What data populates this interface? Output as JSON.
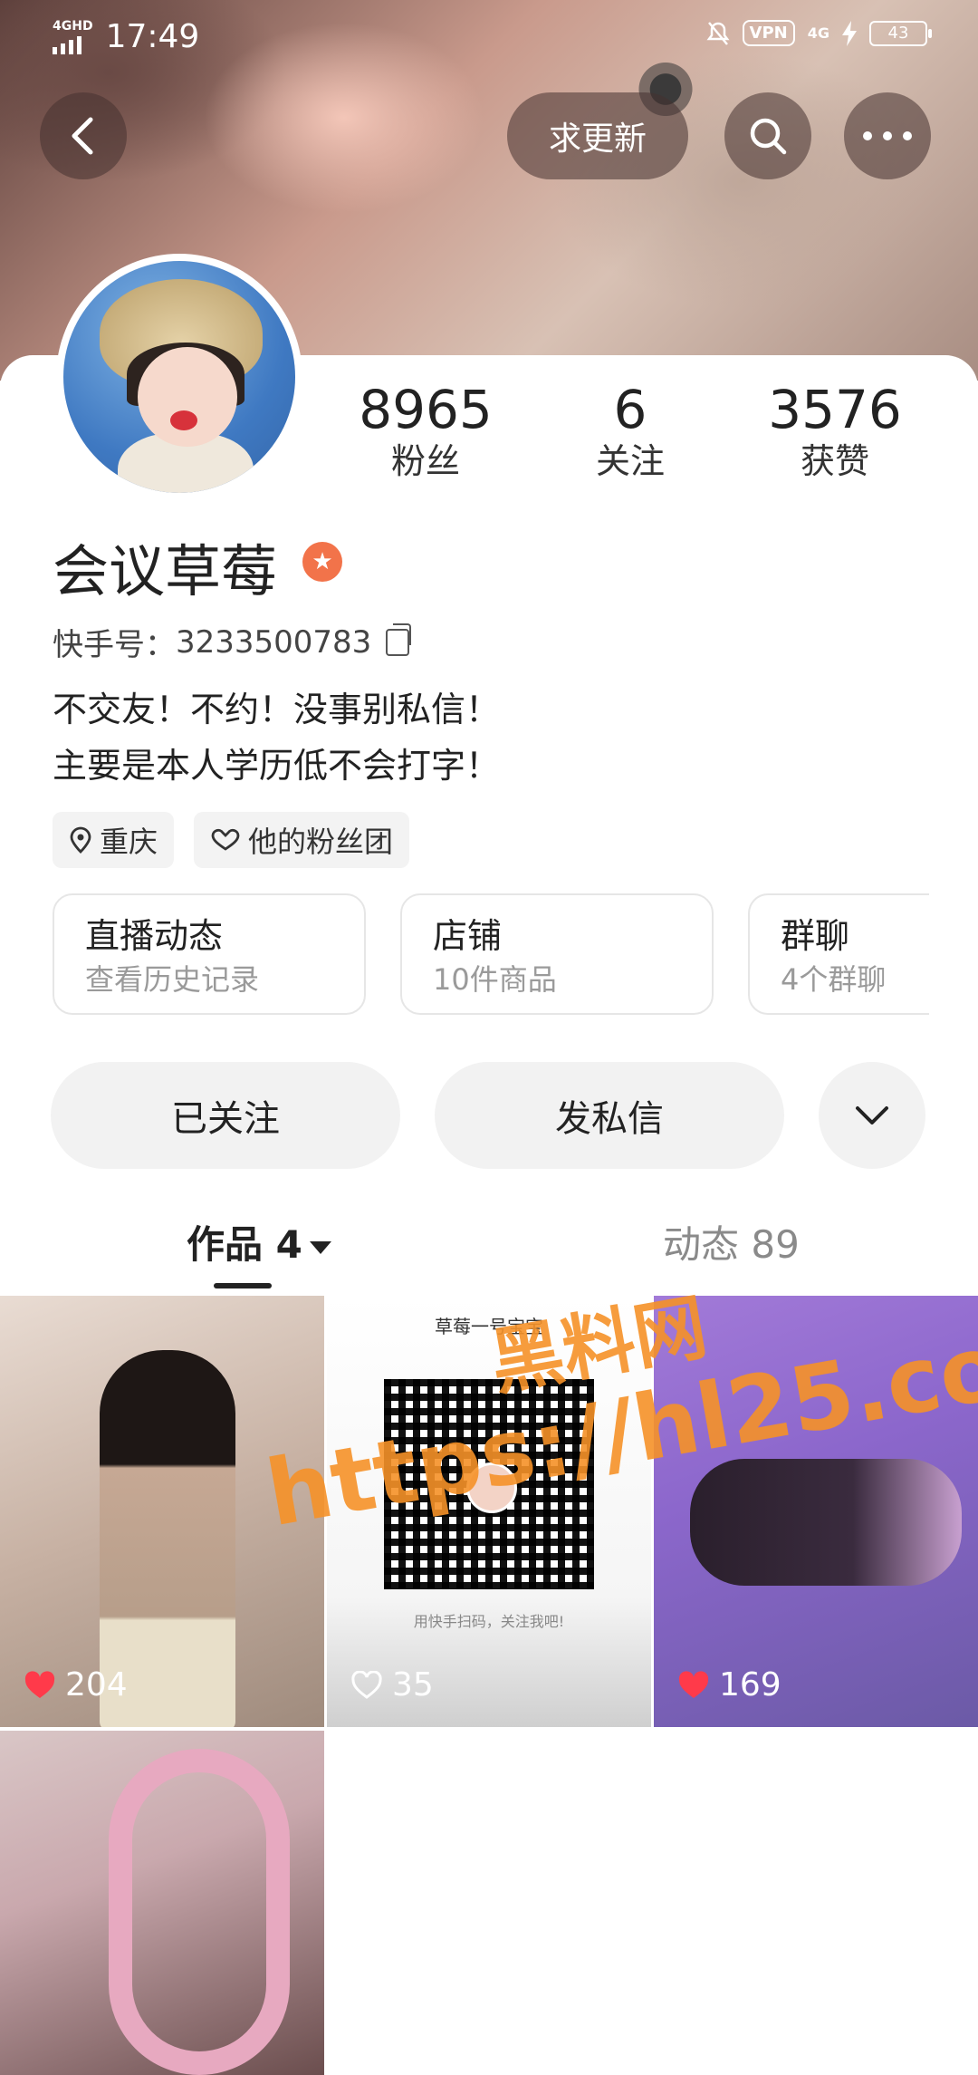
{
  "status_bar": {
    "network": "4GHD",
    "time": "17:49",
    "vpn": "VPN",
    "network2": "4G",
    "battery": "43"
  },
  "top_bar": {
    "update_label": "求更新"
  },
  "profile": {
    "stats": [
      {
        "value": "8965",
        "label": "粉丝"
      },
      {
        "value": "6",
        "label": "关注"
      },
      {
        "value": "3576",
        "label": "获赞"
      }
    ],
    "name": "会议草莓",
    "id_label": "快手号：",
    "id_value": "3233500783",
    "bio_lines": [
      "不交友！不约！没事别私信！",
      "主要是本人学历低不会打字！"
    ],
    "tags": [
      {
        "label": "重庆",
        "icon": "pin-icon"
      },
      {
        "label": "他的粉丝团",
        "icon": "fan-group-icon"
      }
    ]
  },
  "cards": [
    {
      "title": "直播动态",
      "subtitle": "查看历史记录"
    },
    {
      "title": "店铺",
      "subtitle": "10件商品"
    },
    {
      "title": "群聊",
      "subtitle": "4个群聊"
    }
  ],
  "actions": {
    "follow_label": "已关注",
    "message_label": "发私信"
  },
  "tabs": {
    "works_label": "作品 4",
    "dynamics_label": "动态 89"
  },
  "works": [
    {
      "likes": "204",
      "liked": true
    },
    {
      "likes": "35",
      "liked": false,
      "qr_title": "草莓一号宝宝",
      "qr_footer": "用快手扫码，关注我吧!"
    },
    {
      "likes": "169",
      "liked": true
    },
    {},
    {}
  ],
  "watermark": {
    "line1": "黑料网",
    "line2": "https://hl25.co"
  },
  "colors": {
    "accent": "#f2734a",
    "like_red": "#ff3a4a",
    "watermark": "#f5912a"
  }
}
